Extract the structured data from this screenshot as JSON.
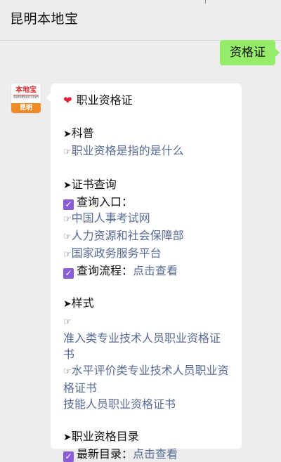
{
  "header": {
    "title": "昆明本地宝"
  },
  "sent_message": {
    "text": "资格证"
  },
  "avatar": {
    "brand": "本地宝",
    "sub": "bendibao.com",
    "city": "昆明"
  },
  "received_message": {
    "heading": "职业资格证",
    "sections": [
      {
        "title": "科普",
        "links": [
          "职业资格是指的是什么"
        ]
      },
      {
        "title": "证书查询",
        "entry_label": "查询入口：",
        "links": [
          "中国人事考试网",
          "人力资源和社会保障部",
          "国家政务服务平台"
        ],
        "process_label": "查询流程：",
        "process_link": "点击查看"
      },
      {
        "title": "样式",
        "links": [
          "准入类专业技术人员职业资格证书",
          "水平评价类专业技术人员职业资格证书",
          "技能人员职业资格证书"
        ]
      },
      {
        "title": "职业资格目录",
        "latest_label": "最新目录：",
        "latest_link": "点击查看"
      }
    ]
  },
  "icons": {
    "heart": "heart-icon",
    "arrow": "arrow-right-icon",
    "hand": "pointing-hand-icon",
    "check": "checkbox-checked-icon"
  },
  "colors": {
    "link": "#576b95",
    "sent_bubble": "#95ec69",
    "check": "#8a5cd8",
    "heart": "#e0223a"
  }
}
